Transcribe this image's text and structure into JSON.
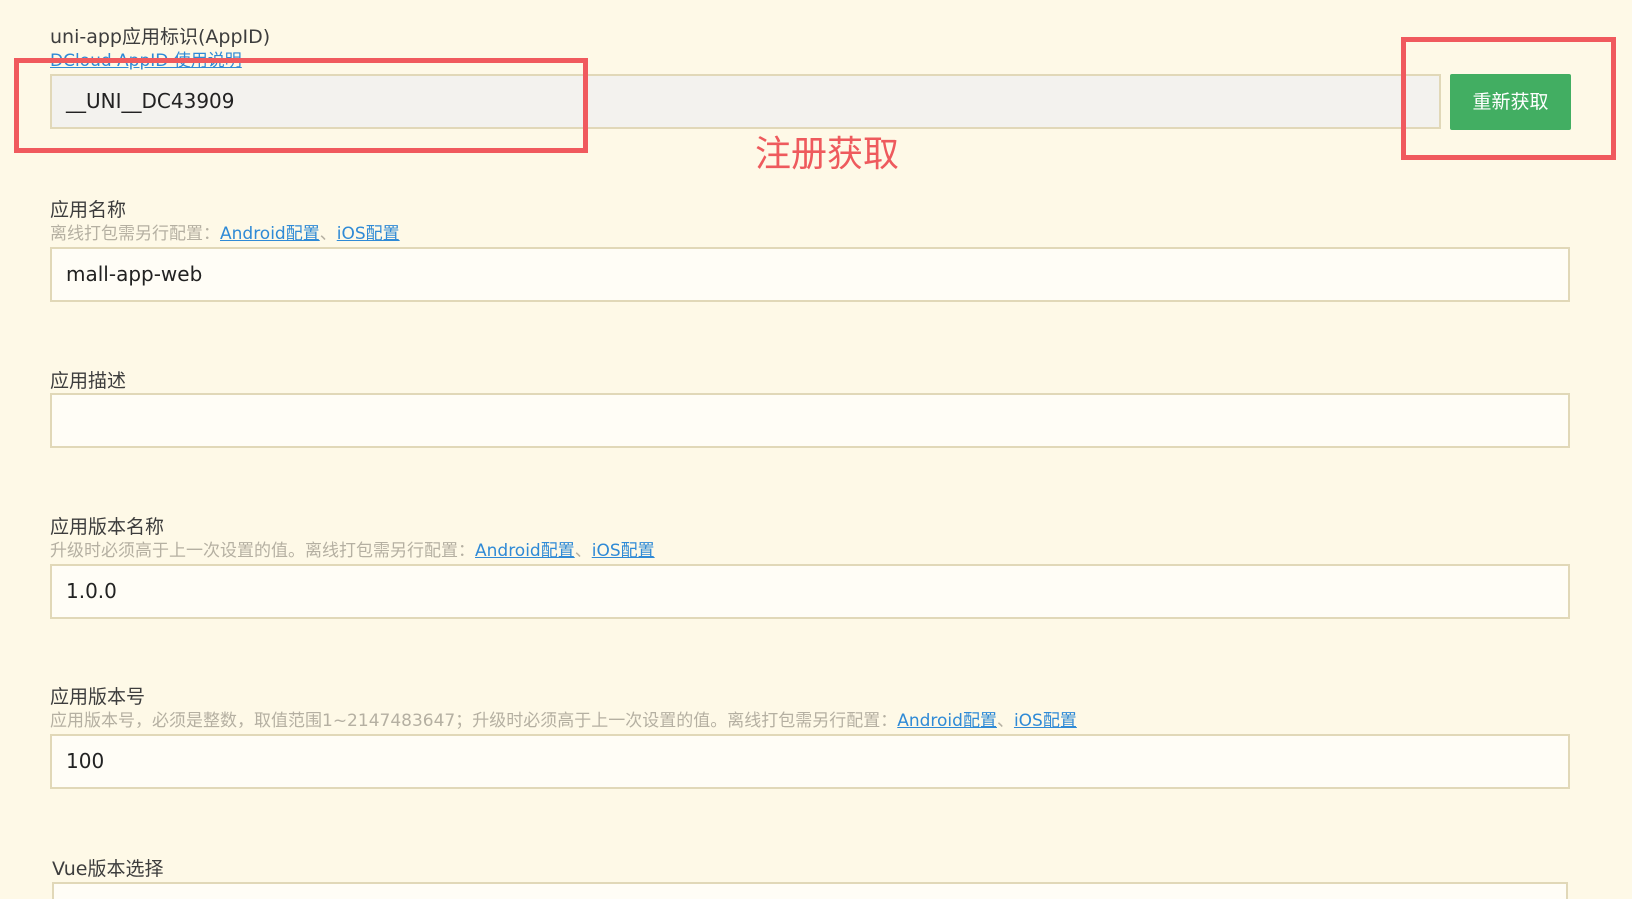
{
  "appid": {
    "label": "uni-app应用标识(AppID)",
    "help_link": "DCloud AppID 使用说明",
    "value": "__UNI__DC43909",
    "button": "重新获取",
    "annotation": "注册获取"
  },
  "app_name": {
    "label": "应用名称",
    "hint": "离线打包需另行配置：",
    "android_link": "Android配置",
    "separator": "、",
    "ios_link": "iOS配置",
    "value": "mall-app-web"
  },
  "app_desc": {
    "label": "应用描述",
    "value": ""
  },
  "version_name": {
    "label": "应用版本名称",
    "hint": "升级时必须高于上一次设置的值。离线打包需另行配置：",
    "android_link": "Android配置",
    "separator": "、",
    "ios_link": "iOS配置",
    "value": "1.0.0"
  },
  "version_code": {
    "label": "应用版本号",
    "hint": "应用版本号，必须是整数，取值范围1~2147483647；升级时必须高于上一次设置的值。离线打包需另行配置：",
    "android_link": "Android配置",
    "separator": "、",
    "ios_link": "iOS配置",
    "value": "100"
  },
  "vue_version": {
    "label": "Vue版本选择"
  },
  "colors": {
    "background": "#fef9e7",
    "accent_button": "#42ae62",
    "annotation_red": "#f05a5e",
    "link": "#2f8ad6"
  }
}
